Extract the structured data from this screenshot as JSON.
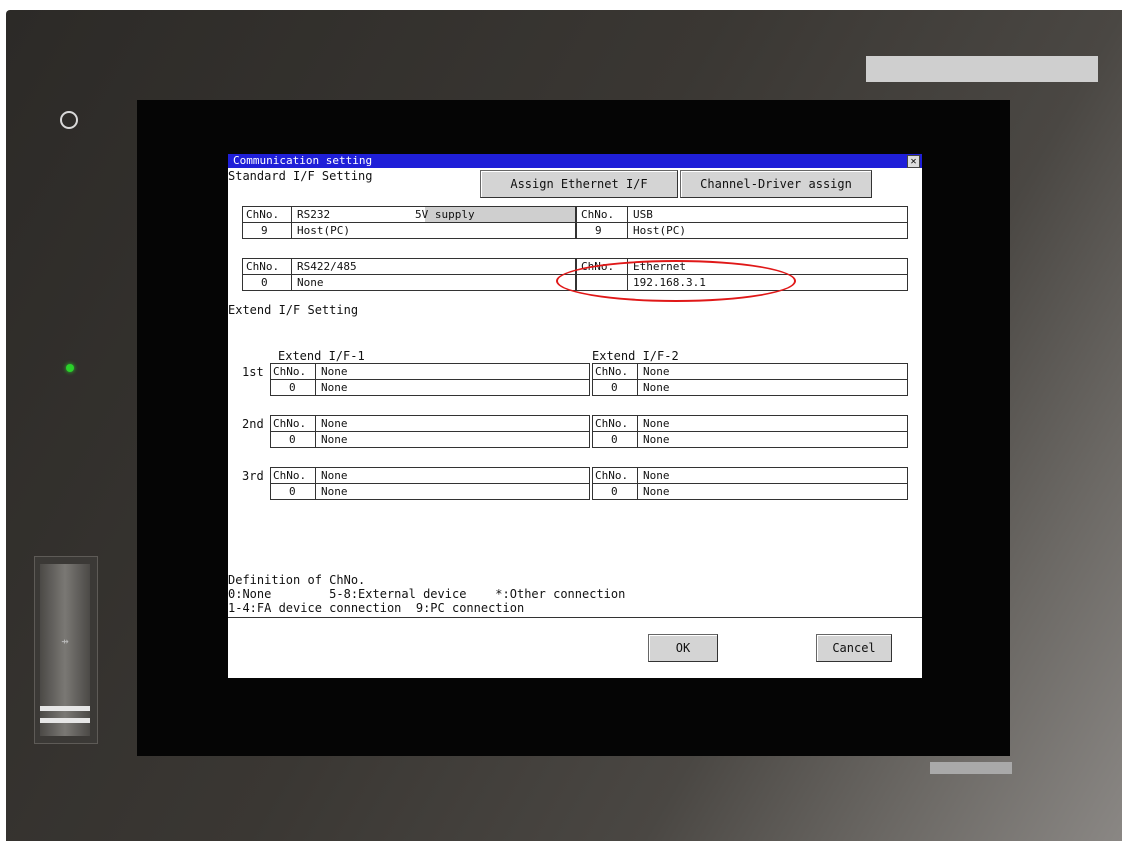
{
  "dialog": {
    "title": "Communication setting",
    "close_glyph": "✕",
    "standard_label": "Standard I/F Setting",
    "assign_ethernet_label": "Assign Ethernet I/F",
    "channel_driver_label": "Channel-Driver assign",
    "extend_label": "Extend I/F Setting",
    "ok_label": "OK",
    "cancel_label": "Cancel"
  },
  "standard": {
    "rs232": {
      "ch_header": "ChNo.",
      "name": "RS232",
      "supply": "5V supply",
      "ch": "9",
      "value": "Host(PC)"
    },
    "usb": {
      "ch_header": "ChNo.",
      "name": "USB",
      "ch": "9",
      "value": "Host(PC)"
    },
    "rs422": {
      "ch_header": "ChNo.",
      "name": "RS422/485",
      "ch": "0",
      "value": "None"
    },
    "ethernet": {
      "ch_header": "ChNo.",
      "name": "Ethernet",
      "ch": "",
      "value": "192.168.3.1"
    }
  },
  "extend": {
    "col1_title": "Extend I/F-1",
    "col2_title": "Extend I/F-2",
    "rows": [
      {
        "label": "1st",
        "left": {
          "ch_header": "ChNo.",
          "name": "None",
          "ch": "0",
          "value": "None"
        },
        "right": {
          "ch_header": "ChNo.",
          "name": "None",
          "ch": "0",
          "value": "None"
        }
      },
      {
        "label": "2nd",
        "left": {
          "ch_header": "ChNo.",
          "name": "None",
          "ch": "0",
          "value": "None"
        },
        "right": {
          "ch_header": "ChNo.",
          "name": "None",
          "ch": "0",
          "value": "None"
        }
      },
      {
        "label": "3rd",
        "left": {
          "ch_header": "ChNo.",
          "name": "None",
          "ch": "0",
          "value": "None"
        },
        "right": {
          "ch_header": "ChNo.",
          "name": "None",
          "ch": "0",
          "value": "None"
        }
      }
    ]
  },
  "definition": {
    "title": "Definition of ChNo.",
    "line1": "0:None        5-8:External device    *:Other connection",
    "line2": "1-4:FA device connection  9:PC connection"
  },
  "device": {
    "usb_icon": "usb-icon"
  },
  "colors": {
    "titlebar": "#1f1fd8",
    "annotation": "#e01818",
    "led": "#2ad12a"
  }
}
